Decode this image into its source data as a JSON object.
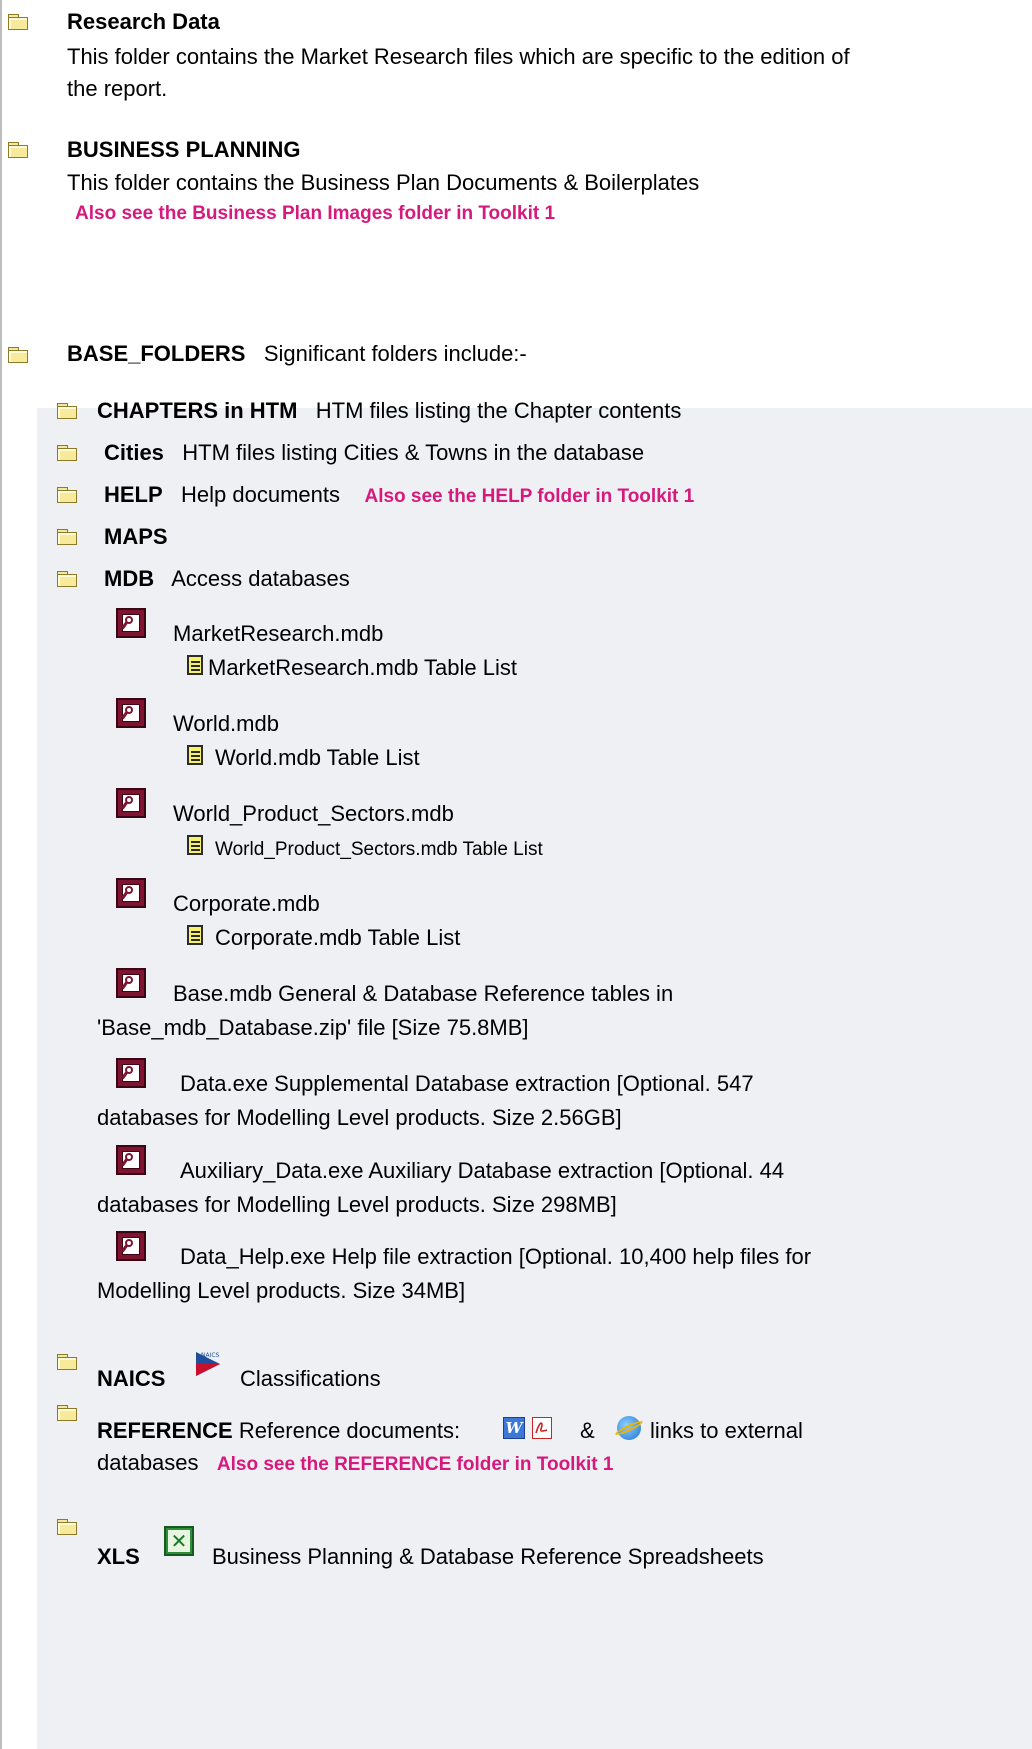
{
  "sections": {
    "research": {
      "title": "Research Data",
      "desc_line1": "This folder contains the Market Research files which are specific to the edition of",
      "desc_line2": "the report."
    },
    "business": {
      "title": "BUSINESS PLANNING",
      "desc": "This folder contains the Business Plan Documents & Boilerplates",
      "note": "Also see the Business Plan Images folder in Toolkit 1"
    },
    "base": {
      "title": "BASE_FOLDERS",
      "desc": "Significant folders include:-"
    }
  },
  "folders": {
    "chapters": {
      "name": "CHAPTERS in HTM",
      "desc": "HTM files listing the Chapter contents"
    },
    "cities": {
      "name": "Cities",
      "desc": "HTM files listing Cities & Towns in the database"
    },
    "help": {
      "name": "HELP",
      "desc": "Help documents",
      "note": "Also see the HELP folder in Toolkit 1"
    },
    "maps": {
      "name": "MAPS"
    },
    "mdb": {
      "name": "MDB",
      "desc": "Access databases"
    },
    "naics": {
      "name": "NAICS",
      "desc": "Classifications",
      "logo_text": "NAICS"
    },
    "reference": {
      "name": "REFERENCE",
      "desc_line1": "Reference documents:",
      "amp": "&",
      "desc_line1b": "links to external",
      "desc_line2": "databases",
      "note": "Also see the REFERENCE folder in Toolkit 1"
    },
    "xls": {
      "name": "XLS",
      "desc": "Business Planning & Database Reference Spreadsheets"
    }
  },
  "databases": {
    "market_research": {
      "name": "MarketResearch.mdb",
      "table_list": "MarketResearch.mdb Table List"
    },
    "world": {
      "name": "World.mdb",
      "table_list": "World.mdb Table List"
    },
    "world_product": {
      "name": "World_Product_Sectors.mdb",
      "table_list": "World_Product_Sectors.mdb Table List"
    },
    "corporate": {
      "name": "Corporate.mdb",
      "table_list": "Corporate.mdb Table List"
    },
    "base": {
      "line1": "Base.mdb   General & Database Reference tables in",
      "line2": "'Base_mdb_Database.zip' file [Size 75.8MB]"
    },
    "data": {
      "line1": "Data.exe   Supplemental Database extraction [Optional. 547",
      "line2": "databases for Modelling Level products. Size 2.56GB]"
    },
    "auxiliary": {
      "line1": "Auxiliary_Data.exe   Auxiliary Database extraction [Optional. 44",
      "line2": "databases for Modelling Level products. Size 298MB]"
    },
    "data_help": {
      "line1": "Data_Help.exe   Help file extraction [Optional. 10,400 help files for",
      "line2": "Modelling Level products. Size 34MB]"
    }
  },
  "icons": {
    "folder": "folder-icon",
    "access": "access-database-icon",
    "document": "document-icon",
    "naics": "naics-logo-icon",
    "word": "word-icon",
    "pdf": "pdf-icon",
    "ie": "internet-explorer-icon",
    "excel": "excel-icon"
  },
  "colors": {
    "accent": "#d6197d",
    "shade": "#eef0f4"
  }
}
